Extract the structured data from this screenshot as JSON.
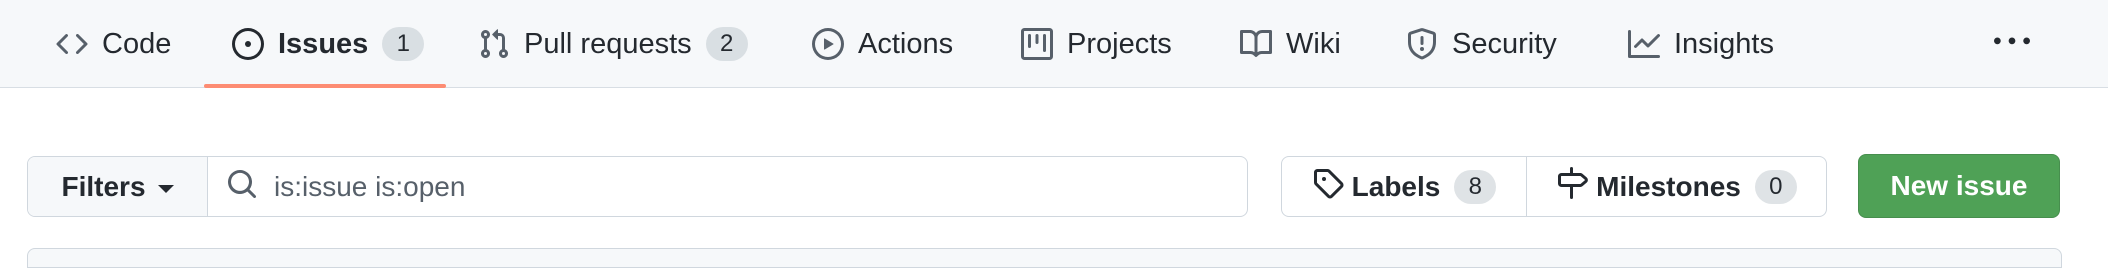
{
  "nav": {
    "tabs": [
      {
        "label": "Code",
        "icon": "code-icon",
        "counter": null
      },
      {
        "label": "Issues",
        "icon": "issue-opened-icon",
        "counter": "1",
        "selected": true
      },
      {
        "label": "Pull requests",
        "icon": "git-pull-request-icon",
        "counter": "2"
      },
      {
        "label": "Actions",
        "icon": "play-icon",
        "counter": null
      },
      {
        "label": "Projects",
        "icon": "table-icon",
        "counter": null
      },
      {
        "label": "Wiki",
        "icon": "book-icon",
        "counter": null
      },
      {
        "label": "Security",
        "icon": "shield-icon",
        "counter": null
      },
      {
        "label": "Insights",
        "icon": "graph-icon",
        "counter": null
      }
    ],
    "more_icon": "kebab-horizontal-icon",
    "selected_underline_color": "#fd8c73"
  },
  "toolbar": {
    "filters_label": "Filters",
    "search_value": "is:issue is:open",
    "labels_label": "Labels",
    "labels_count": "8",
    "milestones_label": "Milestones",
    "milestones_count": "0",
    "new_issue_label": "New issue",
    "new_issue_color": "#4fa156"
  }
}
